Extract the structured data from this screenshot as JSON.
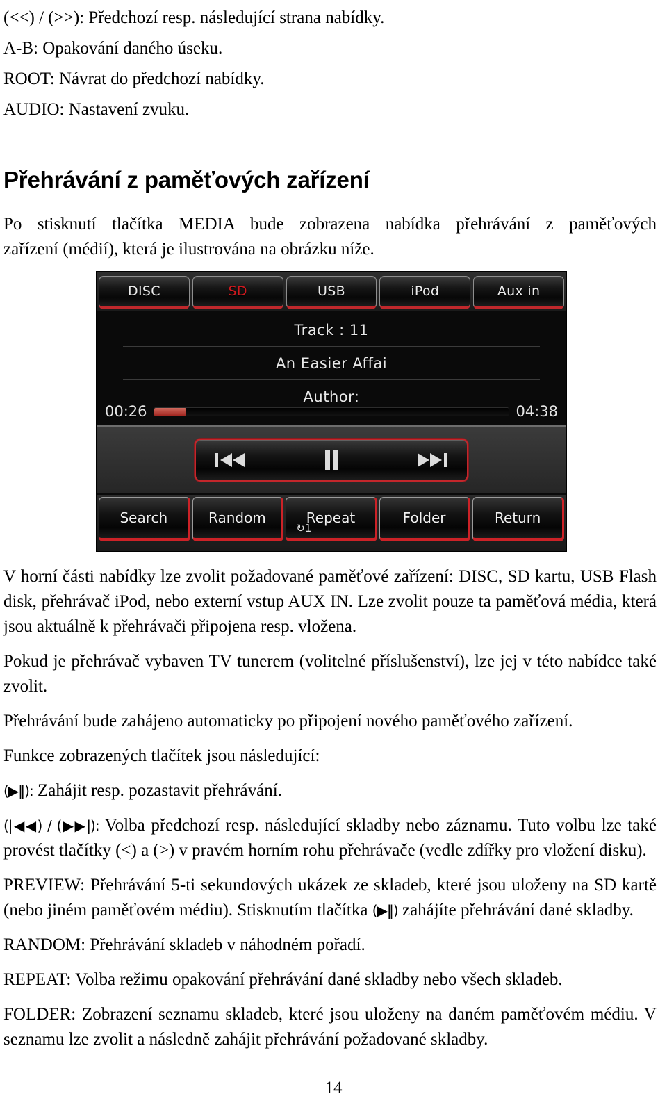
{
  "document": {
    "page_number": "14",
    "top_list": [
      "(<<) / (>>): Předchozí resp. následující strana nabídky.",
      "A-B: Opakování daného úseku.",
      "ROOT: Návrat do předchozí nabídky.",
      "AUDIO: Nastavení zvuku."
    ],
    "heading": "Přehrávání z paměťových zařízení",
    "intro": {
      "line1": "Po stisknutí tlačítka MEDIA bude zobrazena nabídka přehrávání z paměťových",
      "line2": "zařízení (médií), která je ilustrována na obrázku níže."
    },
    "paragraphs": [
      "V horní části nabídky lze zvolit požadované paměťové zařízení: DISC, SD kartu, USB Flash disk, přehrávač iPod, nebo externí vstup AUX IN. Lze zvolit pouze ta paměťová média, která jsou aktuálně k přehrávači připojena resp. vložena.",
      "Pokud je přehrávač vybaven TV tunerem (volitelné příslušenství), lze jej v této nabídce také zvolit.",
      "Přehrávání bude zahájeno automaticky po připojení nového paměťového zařízení.",
      "Funkce zobrazených tlačítek jsou následující:"
    ],
    "button_functions": {
      "play_pause": {
        "symbol": "(▶‖):",
        "text": " Zahájit resp. pozastavit přehrávání."
      },
      "prev_next": {
        "symbol": "(|◀◀) / (▶▶|):",
        "text": " Volba předchozí resp. následující skladby nebo záznamu. Tuto volbu lze také provést tlačítky (<) a (>) v pravém horním rohu přehrávače (vedle zdířky pro vložení disku)."
      },
      "preview": {
        "prefix": "PREVIEW: Přehrávání 5-ti sekundových ukázek ze skladeb, které jsou uloženy na SD kartě (nebo jiném paměťovém médiu). Stisknutím tlačítka ",
        "symbol": "(▶‖)",
        "suffix": " zahájíte přehrávání dané skladby."
      },
      "random": "RANDOM: Přehrávání skladeb v náhodném pořadí.",
      "repeat": "REPEAT: Volba režimu opakování přehrávání dané skladby nebo všech skladeb.",
      "folder": "FOLDER: Zobrazení seznamu skladeb, které jsou uloženy na daném paměťovém médiu. V seznamu lze zvolit a následně zahájit přehrávání požadované skladby."
    }
  },
  "device_screenshot": {
    "source_tabs": [
      {
        "label": "DISC",
        "active": false
      },
      {
        "label": "SD",
        "active": true
      },
      {
        "label": "USB",
        "active": false
      },
      {
        "label": "iPod",
        "active": false
      },
      {
        "label": "Aux in",
        "active": false
      }
    ],
    "now_playing": {
      "track": "Track : 11",
      "title": "An Easier Affai",
      "author": "Author:",
      "elapsed": "00:26",
      "total": "04:38",
      "progress_percent": 9
    },
    "transport": {
      "previous_label": "previous-track",
      "pause_label": "pause",
      "next_label": "next-track"
    },
    "function_buttons": [
      {
        "label": "Search",
        "icon": ""
      },
      {
        "label": "Random",
        "icon": ""
      },
      {
        "label": "Repeat",
        "icon": "↻1"
      },
      {
        "label": "Folder",
        "icon": ""
      },
      {
        "label": "Return",
        "icon": ""
      }
    ],
    "colors": {
      "accent_red": "#c0282c",
      "active_text_red": "#d0191e",
      "panel_black": "#0a0a0a",
      "text_white": "#ededed"
    }
  }
}
